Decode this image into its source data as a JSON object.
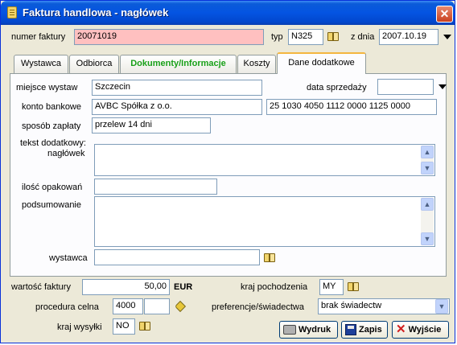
{
  "window": {
    "title": "Faktura handlowa - nagłówek",
    "close": "✕"
  },
  "header": {
    "invoice_no_label": "numer faktury",
    "invoice_no_value": "20071019",
    "type_label": "typ",
    "type_value": "N325",
    "date_label": "z dnia",
    "date_value": "2007.10.19"
  },
  "tabs": [
    {
      "label": "Wystawca",
      "active": false
    },
    {
      "label": "Odbiorca",
      "active": false
    },
    {
      "label": "Dokumenty/Informacje",
      "active": false,
      "highlight": "#19a019"
    },
    {
      "label": "Koszty",
      "active": false
    },
    {
      "label": "Dane dodatkowe",
      "active": true
    }
  ],
  "panel": {
    "place_label": "miejsce wystaw",
    "place_value": "Szczecin",
    "sale_date_label": "data sprzedaży",
    "sale_date_value": "",
    "bank_label": "konto bankowe",
    "bank_name_value": "AVBC Spółka z o.o.",
    "bank_account_value": "25 1030 4050 1112 0000 1125 0000",
    "payment_label": "sposób zapłaty",
    "payment_value": "przelew 14 dni",
    "extra_text_label": "tekst dodatkowy:",
    "header_text_label": "nagłówek",
    "header_text_value": "",
    "packages_label": "ilość opakowań",
    "packages_value": "",
    "summary_label": "podsumowanie",
    "summary_value": "",
    "issuer_label": "wystawca",
    "issuer_value": ""
  },
  "footer": {
    "invoice_value_label": "wartość faktury",
    "invoice_value": "50,00",
    "currency": "EUR",
    "origin_label": "kraj pochodzenia",
    "origin_value": "MY",
    "procedure_label": "procedura celna",
    "procedure_value": "4000",
    "procedure_value2": "",
    "preference_label": "preferencje/świadectwa",
    "preference_value": "brak świadectw",
    "dispatch_label": "kraj wysyłki",
    "dispatch_value": "NO"
  },
  "buttons": {
    "print": "Wydruk",
    "save": "Zapis",
    "exit": "Wyjście"
  },
  "colors": {
    "invoice_no_bg": "#ffc0c0",
    "titlebar": "#0454e2",
    "tab_highlight": "#19a019"
  }
}
